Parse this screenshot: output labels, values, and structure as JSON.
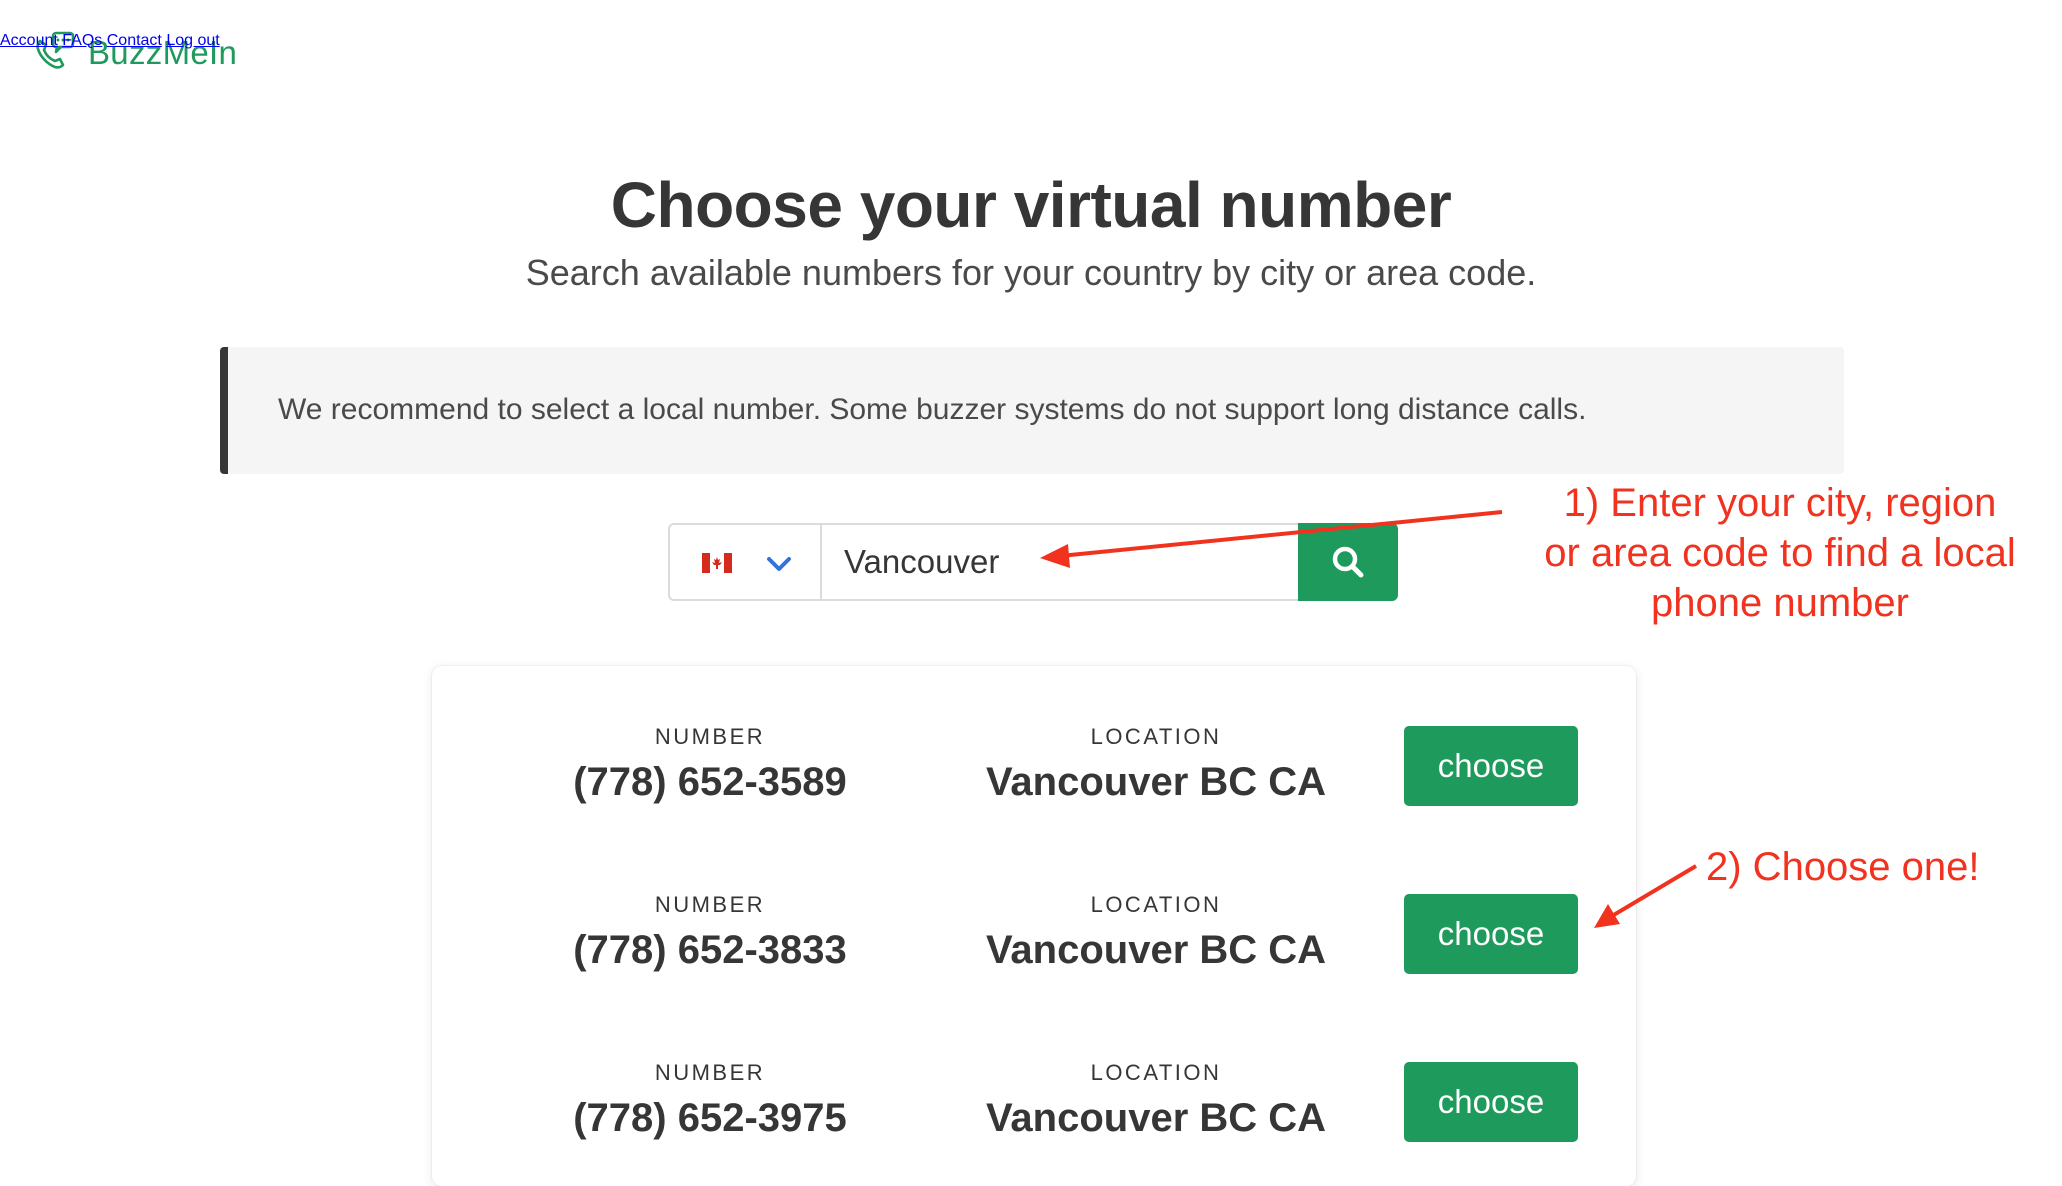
{
  "header": {
    "logo_text": "BuzzMeIn",
    "logo_icon": "phone-chat-icon",
    "nav": [
      {
        "label": "Account"
      },
      {
        "label": "FAQs"
      },
      {
        "label": "Contact"
      },
      {
        "label": "Log out"
      }
    ]
  },
  "hero": {
    "title": "Choose your virtual number",
    "subtitle": "Search available numbers for your country by city or area code."
  },
  "notice": {
    "text": "We recommend to select a local number. Some buzzer systems do not support long distance calls."
  },
  "search": {
    "country_flag": "canada-flag-icon",
    "dropdown_icon": "chevron-down-icon",
    "value": "Vancouver",
    "button_icon": "search-icon"
  },
  "results": {
    "number_heading": "NUMBER",
    "location_heading": "LOCATION",
    "choose_label": "choose",
    "rows": [
      {
        "number": "(778) 652-3589",
        "location": "Vancouver BC CA"
      },
      {
        "number": "(778) 652-3833",
        "location": "Vancouver BC CA"
      },
      {
        "number": "(778) 652-3975",
        "location": "Vancouver BC CA"
      }
    ]
  },
  "annotations": {
    "step1": [
      "1) Enter your city, region",
      "or area code to find a local",
      "phone number"
    ],
    "step2": "2) Choose one!"
  },
  "colors": {
    "brand_green": "#1e9a5c",
    "annotation_red": "#f0321e",
    "text_dark": "#363636"
  }
}
